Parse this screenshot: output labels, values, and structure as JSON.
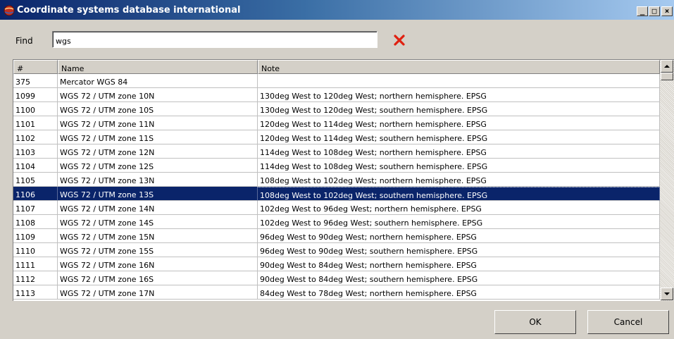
{
  "window": {
    "title": "Coordinate systems database international",
    "minimize_label": "_",
    "maximize_label": "□",
    "close_label": "×"
  },
  "find": {
    "label": "Find",
    "value": "wgs",
    "clear_icon": "red-x-icon"
  },
  "table": {
    "columns": [
      "#",
      "Name",
      "Note"
    ],
    "rows": [
      {
        "id": "375",
        "name": "Mercator WGS 84",
        "note": ""
      },
      {
        "id": "1099",
        "name": "WGS 72 / UTM zone 10N",
        "note": "130deg West to 120deg West; northern hemisphere. EPSG"
      },
      {
        "id": "1100",
        "name": "WGS 72 / UTM zone 10S",
        "note": "130deg West to 120deg West; southern hemisphere. EPSG"
      },
      {
        "id": "1101",
        "name": "WGS 72 / UTM zone 11N",
        "note": "120deg West to 114deg West; northern hemisphere. EPSG"
      },
      {
        "id": "1102",
        "name": "WGS 72 / UTM zone 11S",
        "note": "120deg West to 114deg West; southern hemisphere. EPSG"
      },
      {
        "id": "1103",
        "name": "WGS 72 / UTM zone 12N",
        "note": "114deg West to 108deg West; northern hemisphere. EPSG"
      },
      {
        "id": "1104",
        "name": "WGS 72 / UTM zone 12S",
        "note": "114deg West to 108deg West; southern hemisphere. EPSG"
      },
      {
        "id": "1105",
        "name": "WGS 72 / UTM zone 13N",
        "note": "108deg West to 102deg West; northern hemisphere. EPSG"
      },
      {
        "id": "1106",
        "name": "WGS 72 / UTM zone 13S",
        "note": "108deg West to 102deg West; southern hemisphere. EPSG"
      },
      {
        "id": "1107",
        "name": "WGS 72 / UTM zone 14N",
        "note": "102deg West to 96deg West; northern hemisphere. EPSG"
      },
      {
        "id": "1108",
        "name": "WGS 72 / UTM zone 14S",
        "note": "102deg West to 96deg West; southern hemisphere. EPSG"
      },
      {
        "id": "1109",
        "name": "WGS 72 / UTM zone 15N",
        "note": "96deg West to 90deg West; northern hemisphere. EPSG"
      },
      {
        "id": "1110",
        "name": "WGS 72 / UTM zone 15S",
        "note": "96deg West to 90deg West; southern hemisphere. EPSG"
      },
      {
        "id": "1111",
        "name": "WGS 72 / UTM zone 16N",
        "note": "90deg West to 84deg West; northern hemisphere. EPSG"
      },
      {
        "id": "1112",
        "name": "WGS 72 / UTM zone 16S",
        "note": "90deg West to 84deg West; southern hemisphere. EPSG"
      },
      {
        "id": "1113",
        "name": "WGS 72 / UTM zone 17N",
        "note": "84deg West to 78deg West; northern hemisphere. EPSG"
      }
    ],
    "selected_id": "1106"
  },
  "buttons": {
    "ok": "OK",
    "cancel": "Cancel"
  },
  "colors": {
    "title_gradient_start": "#0a246a",
    "selection": "#0a246a",
    "clear_icon": "#e02010"
  }
}
